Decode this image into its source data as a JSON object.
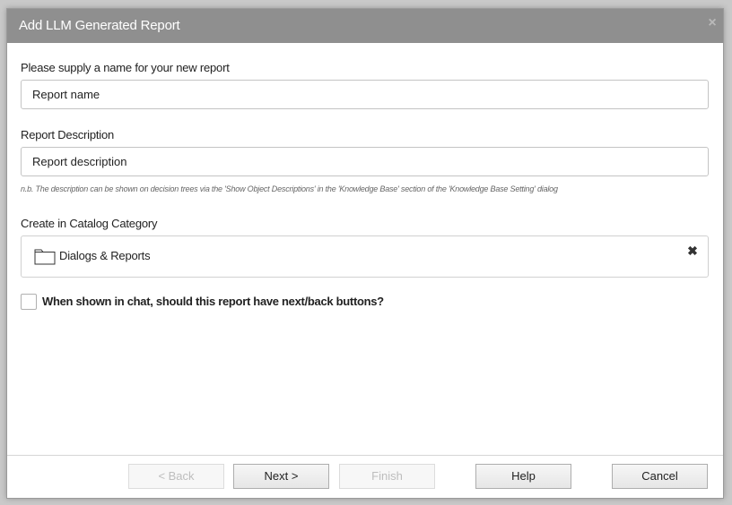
{
  "dialog": {
    "title": "Add LLM Generated Report",
    "close_icon": "close-icon"
  },
  "name_field": {
    "label": "Please supply a name for your new report",
    "value": "Report name"
  },
  "description_field": {
    "label": "Report Description",
    "value": "Report description",
    "note": "n.b. The description can be shown on decision trees via the 'Show Object Descriptions' in the 'Knowledge Base' section of the 'Knowledge Base Setting' dialog"
  },
  "category_field": {
    "label": "Create in Catalog Category",
    "selected": "Dialogs & Reports",
    "icon": "folder-icon",
    "clear_icon": "close-icon"
  },
  "nav_buttons_option": {
    "label": "When shown in chat, should this report have next/back buttons?",
    "checked": false
  },
  "buttons": {
    "back": "< Back",
    "next": "Next >",
    "finish": "Finish",
    "help": "Help",
    "cancel": "Cancel"
  }
}
